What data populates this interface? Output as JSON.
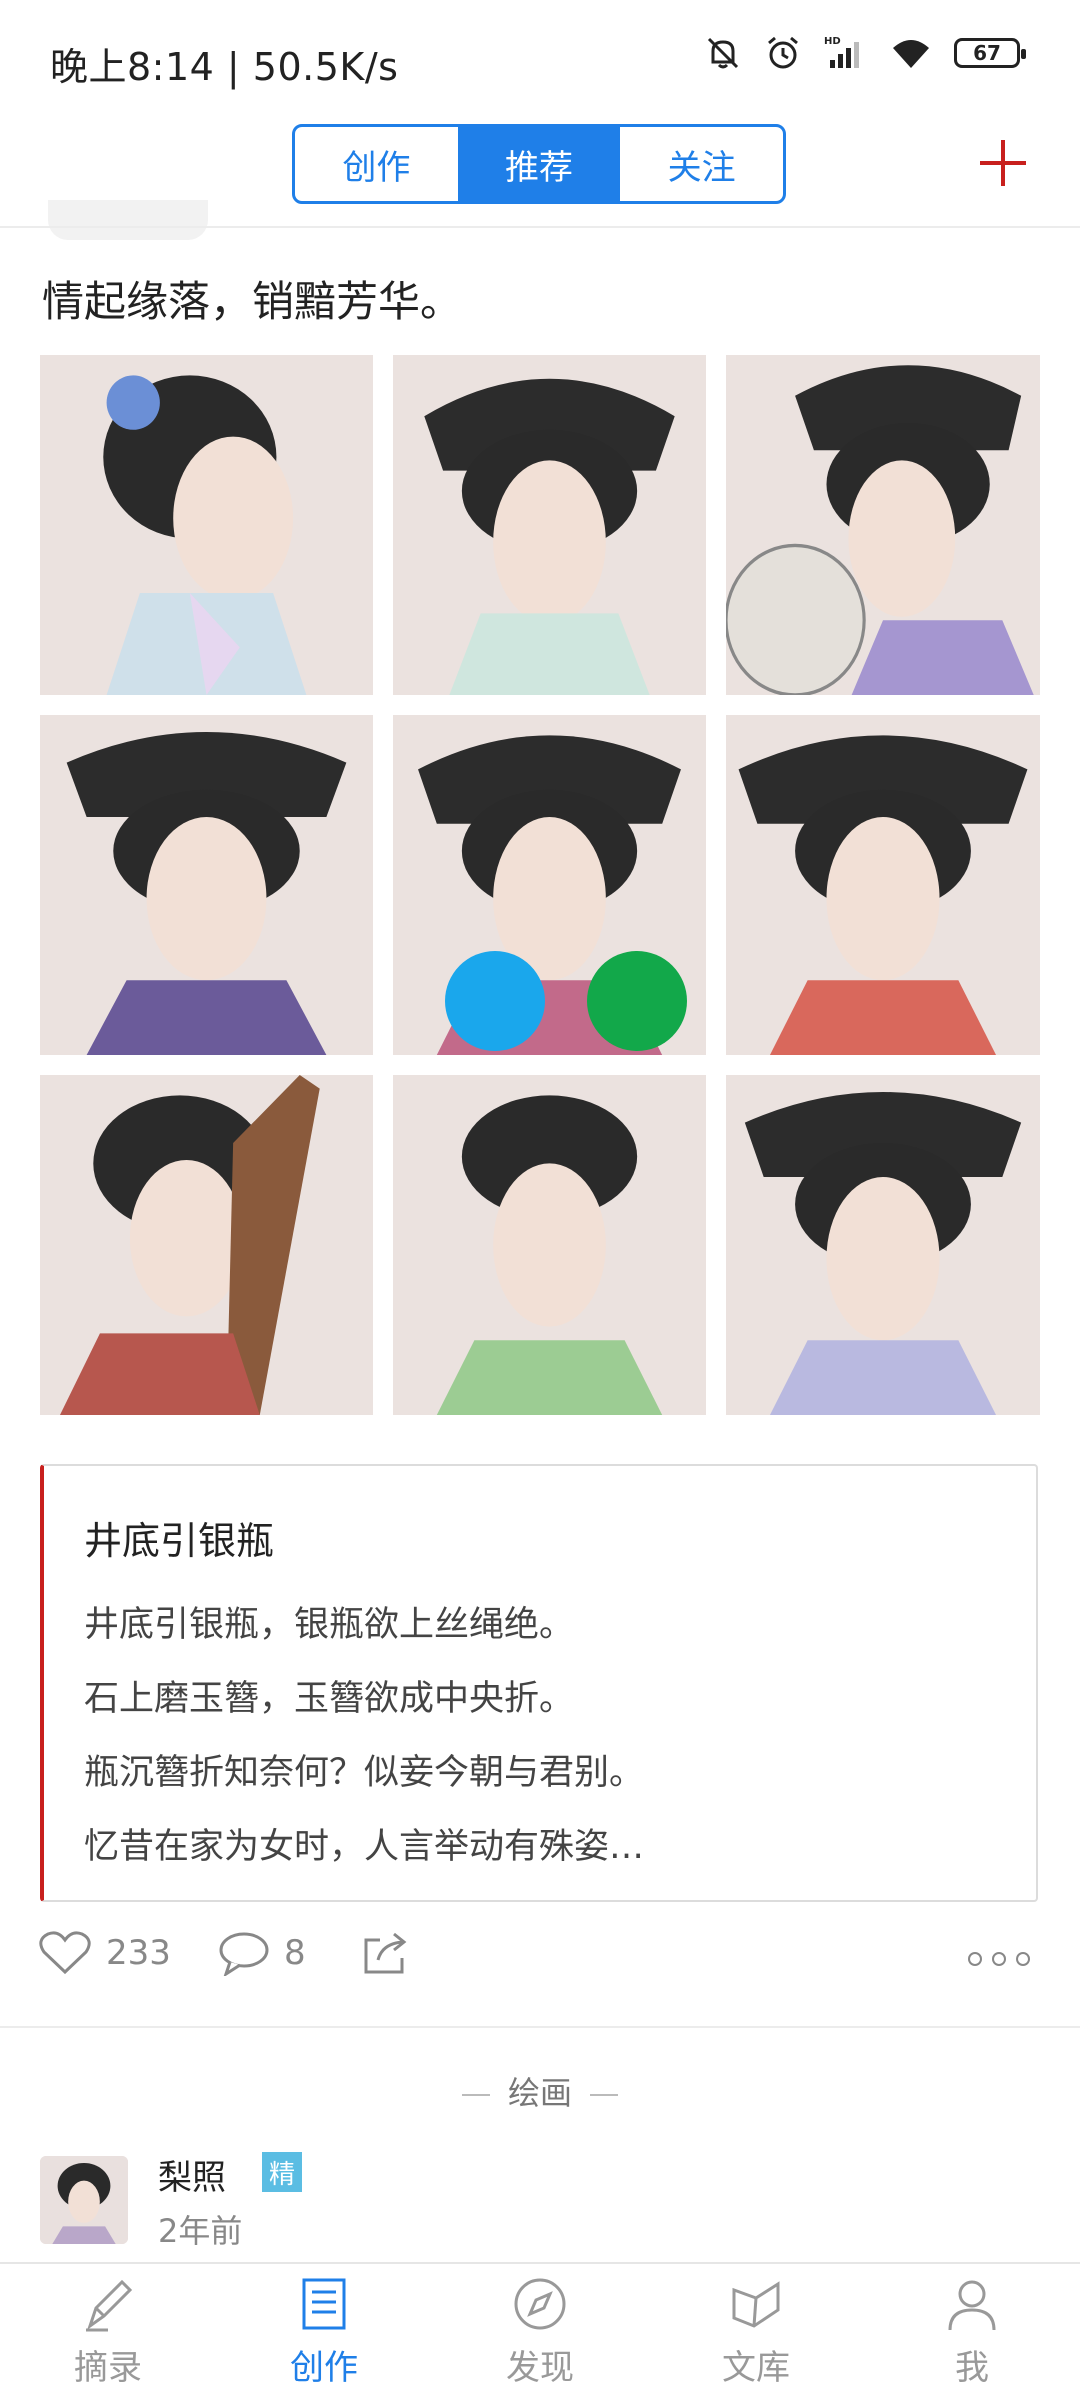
{
  "status_bar": {
    "time": "晚上8:14 | 50.5K/s",
    "battery": "67"
  },
  "header": {
    "tabs": [
      {
        "label": "创作",
        "active": false
      },
      {
        "label": "推荐",
        "active": true
      },
      {
        "label": "关注",
        "active": false
      }
    ]
  },
  "post": {
    "title": "情起缘落，销黯芳华。",
    "images_count": 9,
    "overlay_dots": [
      "#1aa7ec",
      "#12a84a"
    ],
    "quote": {
      "title": "井底引银瓶",
      "lines": [
        "井底引银瓶，银瓶欲上丝绳绝。",
        "石上磨玉簪，玉簪欲成中央折。",
        "瓶沉簪折知奈何？似妾今朝与君别。",
        "忆昔在家为女时，人言举动有殊姿…"
      ]
    },
    "likes": "233",
    "comments": "8",
    "category": "绘画"
  },
  "next_post": {
    "author": "梨照",
    "badge": "精",
    "time": "2年前"
  },
  "bottom_nav": [
    {
      "label": "摘录",
      "icon": "pen-icon",
      "active": false
    },
    {
      "label": "创作",
      "icon": "document-icon",
      "active": true
    },
    {
      "label": "发现",
      "icon": "compass-icon",
      "active": false
    },
    {
      "label": "文库",
      "icon": "books-icon",
      "active": false
    },
    {
      "label": "我",
      "icon": "user-icon",
      "active": false
    }
  ],
  "colors": {
    "accent": "#1f7fe8",
    "red": "#c8201d",
    "badge": "#5bbde3"
  }
}
